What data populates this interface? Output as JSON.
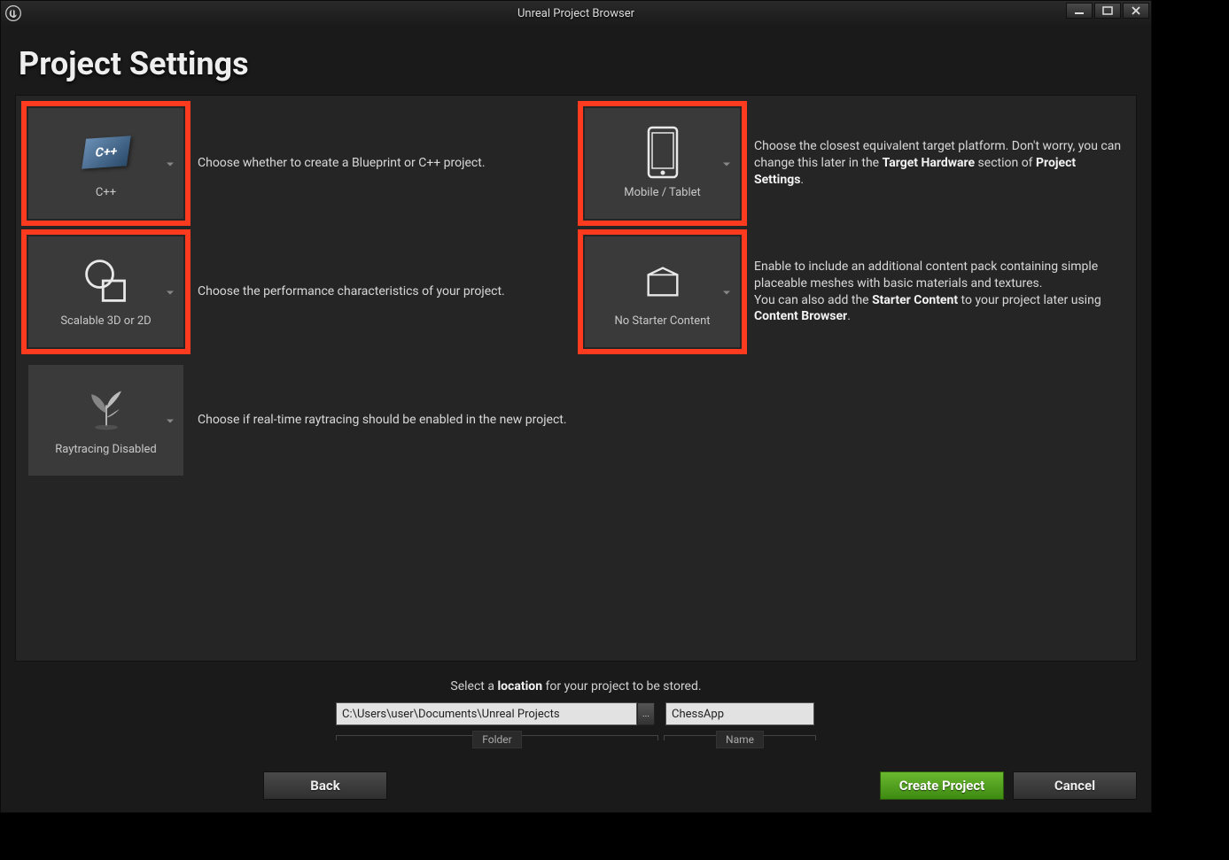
{
  "window": {
    "title": "Unreal Project Browser"
  },
  "page": {
    "title": "Project Settings"
  },
  "tiles": {
    "cpp": {
      "label": "C++",
      "desc_pre": "Choose whether to create a Blueprint or C++ project."
    },
    "platform": {
      "label": "Mobile / Tablet",
      "desc_a": "Choose the closest equivalent target platform. Don't worry, you can change this later in the ",
      "desc_b": "Target Hardware",
      "desc_c": " section of ",
      "desc_d": "Project Settings",
      "desc_e": "."
    },
    "quality": {
      "label": "Scalable 3D or 2D",
      "desc": "Choose the performance characteristics of your project."
    },
    "starter": {
      "label": "No Starter Content",
      "desc_a": "Enable to include an additional content pack containing simple placeable meshes with basic materials and textures.",
      "desc_b": "You can also add the ",
      "desc_c": "Starter Content",
      "desc_d": " to your project later using ",
      "desc_e": "Content Browser",
      "desc_f": "."
    },
    "raytracing": {
      "label": "Raytracing Disabled",
      "desc": "Choose if real-time raytracing should be enabled in the new project."
    }
  },
  "footer": {
    "prompt_a": "Select a ",
    "prompt_b": "location",
    "prompt_c": " for your project to be stored.",
    "folder_value": "C:\\Users\\user\\Documents\\Unreal Projects",
    "folder_label": "Folder",
    "name_value": "ChessApp",
    "name_label": "Name",
    "back": "Back",
    "create": "Create Project",
    "cancel": "Cancel"
  },
  "icons": {
    "cpp_text": "C++"
  }
}
